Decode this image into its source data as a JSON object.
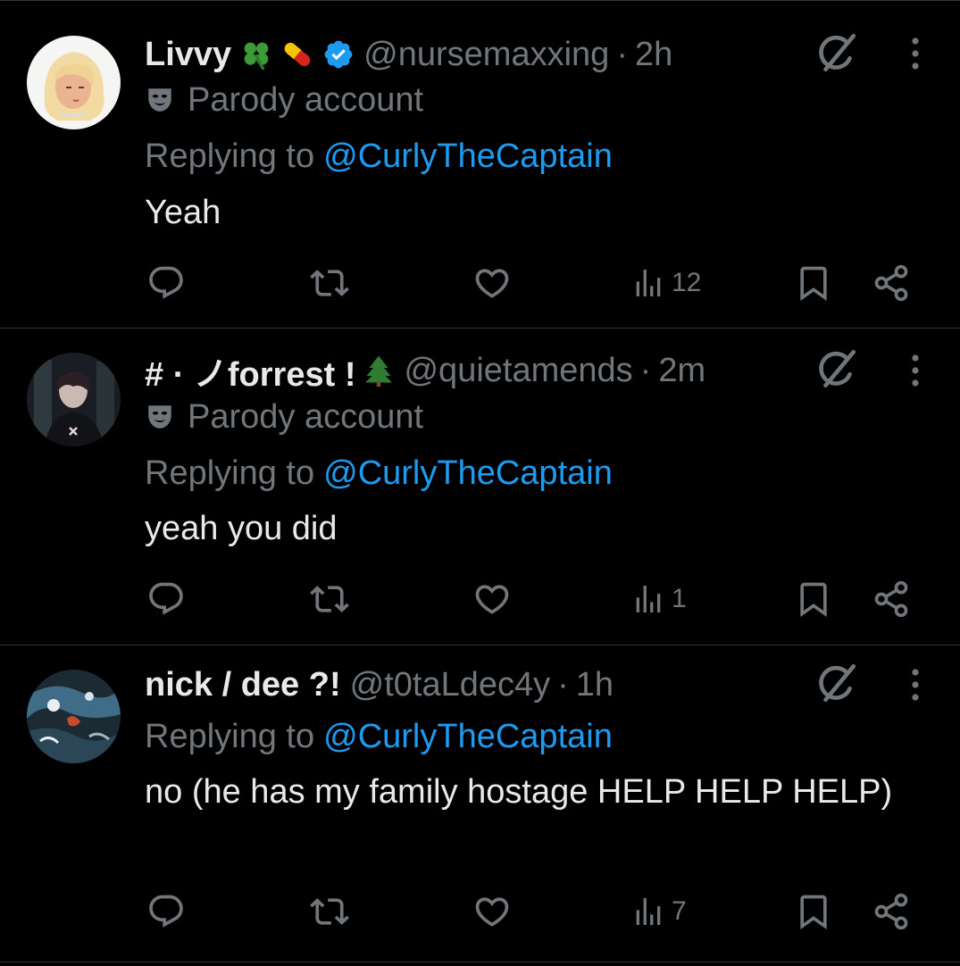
{
  "colors": {
    "background": "#000000",
    "text": "#e7e9ea",
    "muted": "#71767b",
    "link": "#1d9bf0",
    "verified": "#1d9bf0",
    "divider": "#2f3336"
  },
  "posts": [
    {
      "name": "Livvy",
      "name_emoji": [
        "four-leaf-clover-icon",
        "pill-icon"
      ],
      "verified": true,
      "handle": "@nursemaxxing",
      "separator": "·",
      "time": "2h",
      "parody_label": "Parody account",
      "replying_prefix": "Replying to",
      "replying_to": "@CurlyTheCaptain",
      "text": "Yeah",
      "views": "12"
    },
    {
      "name": "# · ノforrest !",
      "name_emoji": [
        "evergreen-tree-icon"
      ],
      "verified": false,
      "handle": "@quietamends",
      "separator": "·",
      "time": "2m",
      "parody_label": "Parody account",
      "replying_prefix": "Replying to",
      "replying_to": "@CurlyTheCaptain",
      "text": "yeah you did",
      "views": "1"
    },
    {
      "name": "nick / dee ?!",
      "name_emoji": [],
      "verified": false,
      "handle": "@t0taLdec4y",
      "separator": "·",
      "time": "1h",
      "replying_prefix": "Replying to",
      "replying_to": "@CurlyTheCaptain",
      "text": "no (he has my family hostage HELP HELP HELP)",
      "views": "7"
    }
  ]
}
